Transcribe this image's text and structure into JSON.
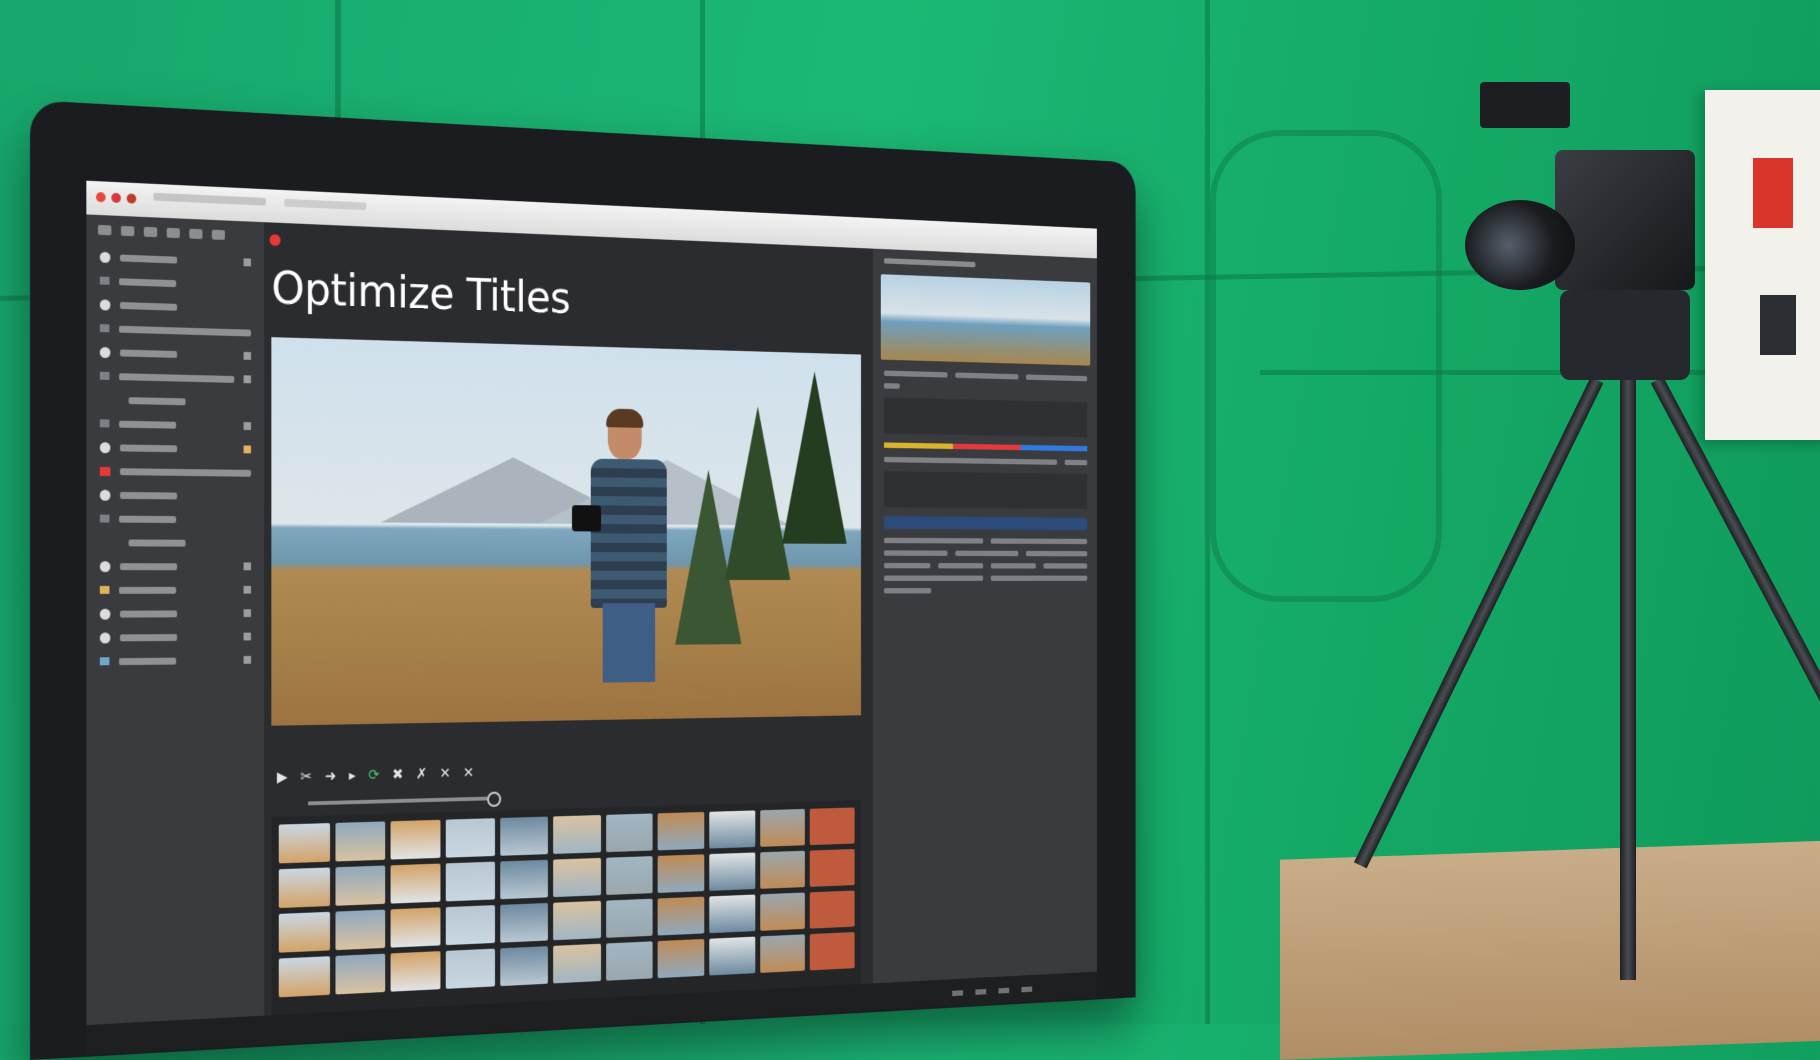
{
  "editor": {
    "page_title": "Optimize Titles"
  },
  "toolbar": {
    "icons": [
      "play-icon",
      "cut-icon",
      "arrow-icon",
      "marker-icon",
      "refresh-icon",
      "close-icon",
      "delete-icon",
      "split-icon"
    ]
  },
  "colors": {
    "backdrop": "#1bb875",
    "record_red": "#e53935",
    "refresh_green": "#3ecf68",
    "selection_blue": "#2c4a7a"
  },
  "filmstrip_palette": [
    "#c9d7e3",
    "#8fa9be",
    "#d3a368",
    "#b8c7d2",
    "#6e8aa0",
    "#d9c2a0",
    "#a1b6c3",
    "#c08b55",
    "#e0e4e6",
    "#9aa7ae",
    "#bf5a3c"
  ]
}
